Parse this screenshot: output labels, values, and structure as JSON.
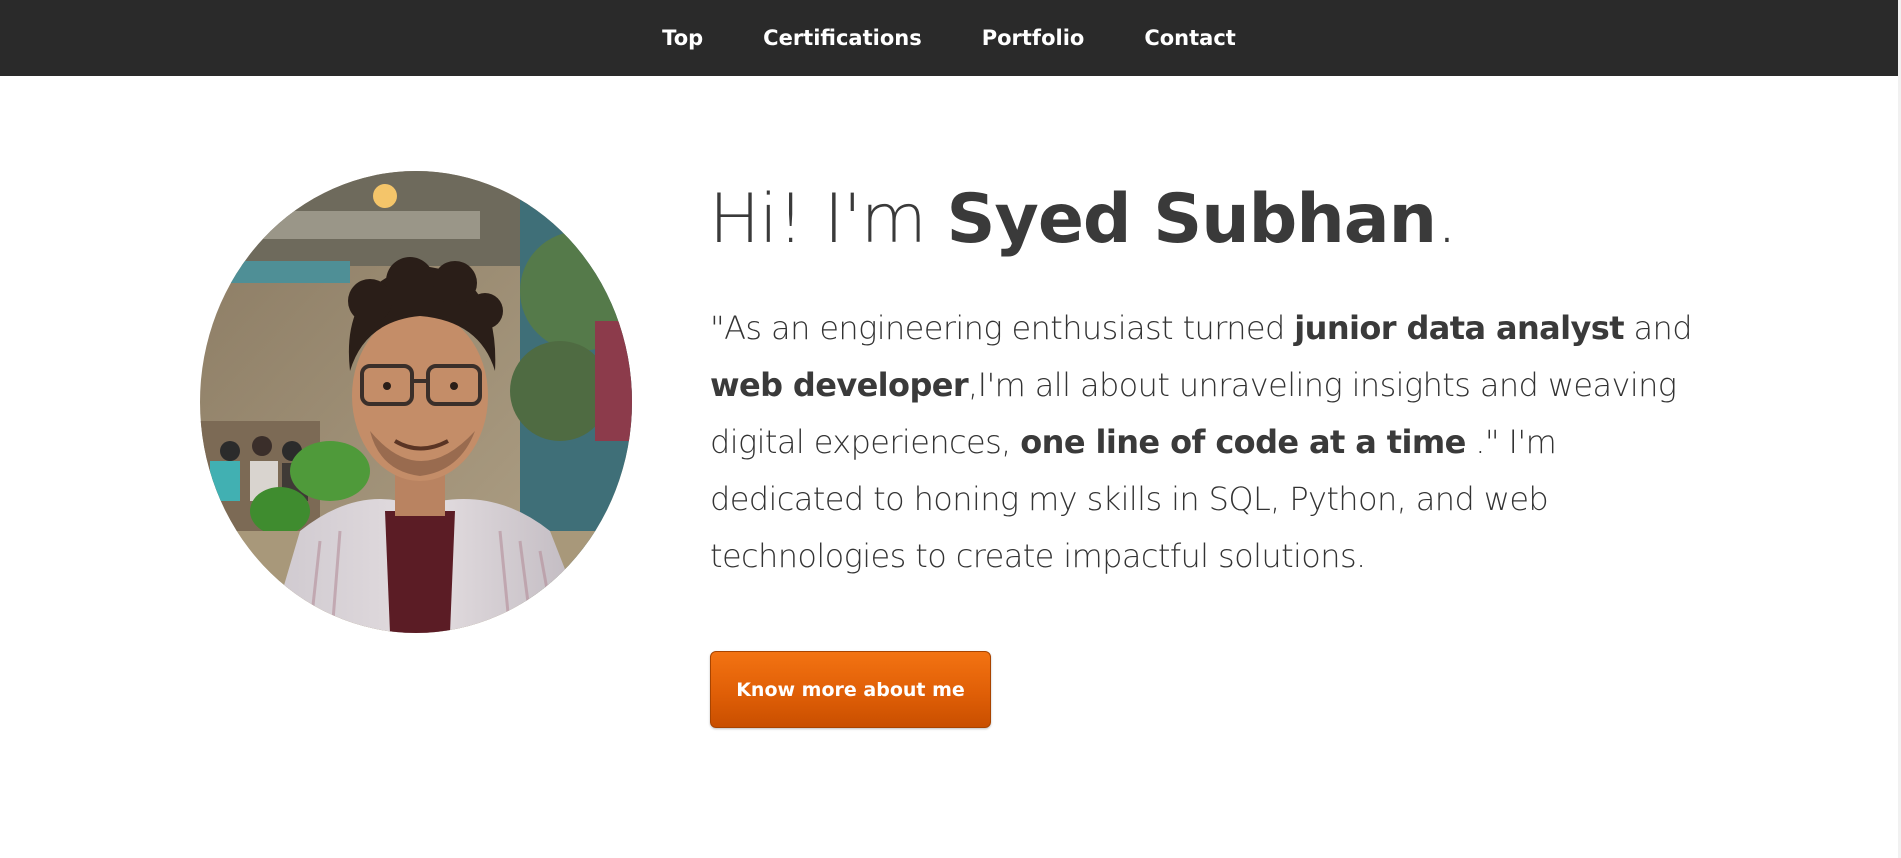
{
  "navbar": {
    "items": [
      {
        "label": "Top"
      },
      {
        "label": "Certifications"
      },
      {
        "label": "Portfolio"
      },
      {
        "label": "Contact"
      }
    ]
  },
  "hero": {
    "title_prefix": "Hi! I'm ",
    "name": "Syed Subhan",
    "title_suffix": ".",
    "description": [
      {
        "text": "\"As an engineering enthusiast turned ",
        "bold": false
      },
      {
        "text": "junior data analyst",
        "bold": true
      },
      {
        "text": " and ",
        "bold": false
      },
      {
        "text": "web developer",
        "bold": true
      },
      {
        "text": ",I'm all about unraveling insights and weaving digital experiences, ",
        "bold": false
      },
      {
        "text": "one line of code at a time",
        "bold": true
      },
      {
        "text": " .\" I'm dedicated to honing my skills in SQL, Python, and web technologies to create impactful solutions.",
        "bold": false
      }
    ],
    "button_label": "Know more about me",
    "avatar_icon": "profile-photo"
  },
  "colors": {
    "navbar_bg": "#2a2a2a",
    "accent": "#e05f07",
    "text": "#333333"
  }
}
